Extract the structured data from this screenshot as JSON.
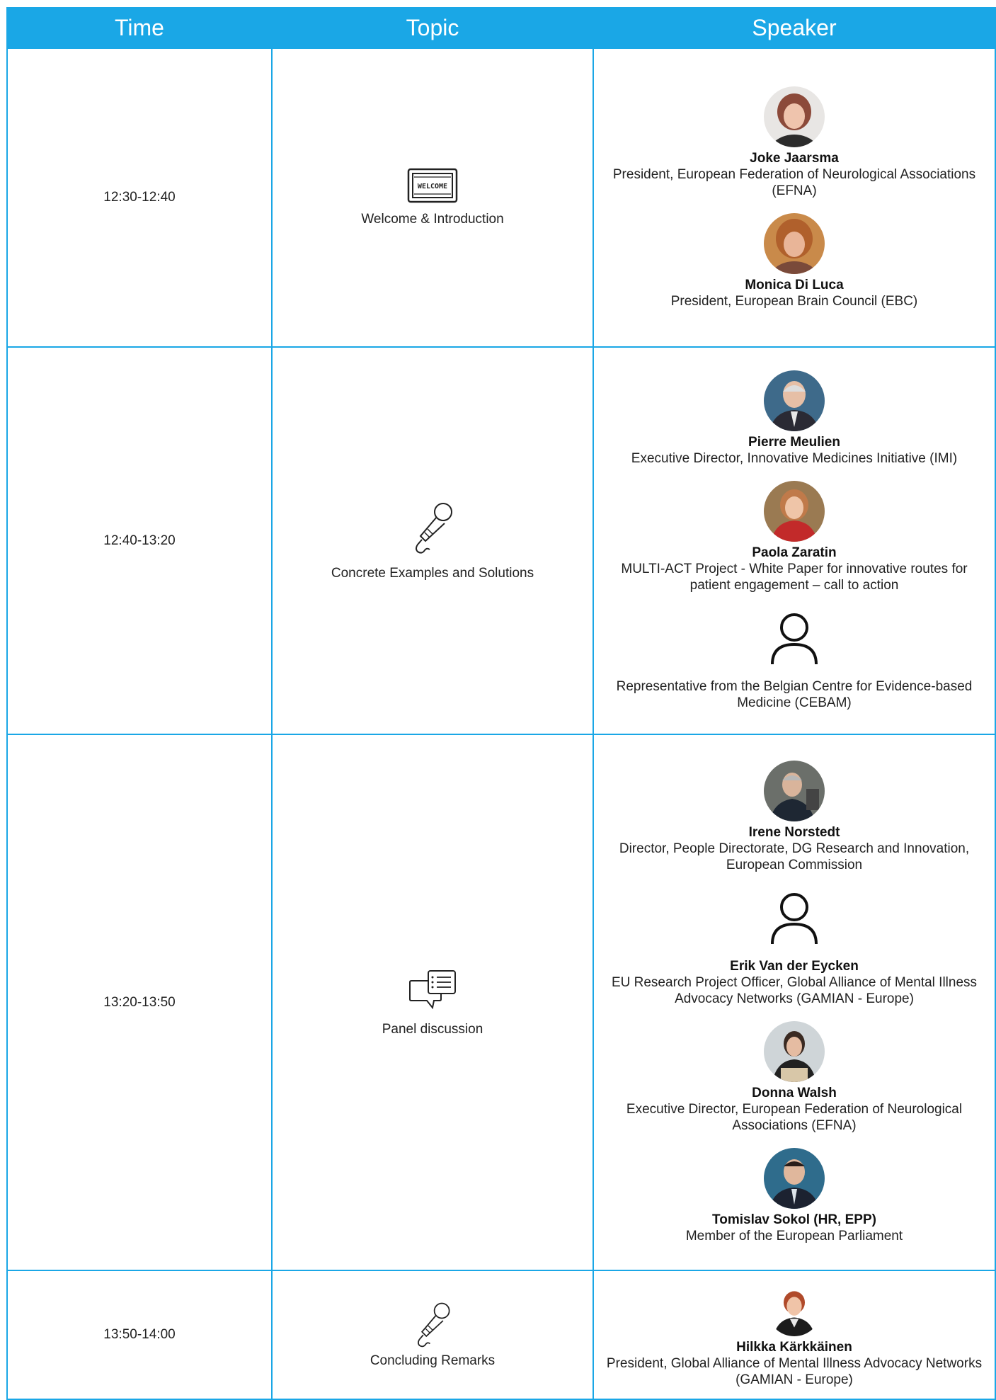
{
  "header": {
    "time": "Time",
    "topic": "Topic",
    "speaker": "Speaker"
  },
  "rows": [
    {
      "time": "12:30-12:40",
      "topic": "Welcome & Introduction",
      "topic_icon": "welcome-sign-icon",
      "welcome_sign_text": "WELCOME",
      "speakers": [
        {
          "name": "Joke Jaarsma",
          "role": "President, European Federation of Neurological Associations (EFNA)"
        },
        {
          "name": "Monica Di Luca",
          "role": "President, European Brain Council (EBC)"
        }
      ]
    },
    {
      "time": "12:40-13:20",
      "topic": "Concrete Examples and Solutions",
      "topic_icon": "microphone-icon",
      "speakers": [
        {
          "name": "Pierre Meulien",
          "role": "Executive Director, Innovative Medicines Initiative (IMI)"
        },
        {
          "name": "Paola Zaratin",
          "role": "MULTI-ACT Project - White Paper for innovative routes for patient engagement – call to action"
        },
        {
          "name": "",
          "role": "Representative from the Belgian Centre for Evidence-based Medicine (CEBAM)"
        }
      ]
    },
    {
      "time": "13:20-13:50",
      "topic": "Panel discussion",
      "topic_icon": "chat-bubbles-icon",
      "speakers": [
        {
          "name": "Irene Norstedt",
          "role": "Director, People Directorate, DG Research and Innovation, European Commission"
        },
        {
          "name": "Erik Van der Eycken",
          "role": "EU Research Project Officer, Global Alliance of Mental Illness Advocacy Networks (GAMIAN - Europe)"
        },
        {
          "name": "Donna Walsh",
          "role": "Executive Director, European Federation of Neurological Associations (EFNA)"
        },
        {
          "name": "Tomislav Sokol (HR, EPP)",
          "role": "Member of the European Parliament"
        }
      ]
    },
    {
      "time": "13:50-14:00",
      "topic": "Concluding Remarks",
      "topic_icon": "microphone-icon",
      "speakers": [
        {
          "name": "Hilkka Kärkkäinen",
          "role": "President, Global Alliance of Mental Illness Advocacy Networks (GAMIAN - Europe)"
        }
      ]
    }
  ],
  "colors": {
    "accent": "#1aa7e6",
    "header_text": "#ffffff"
  }
}
